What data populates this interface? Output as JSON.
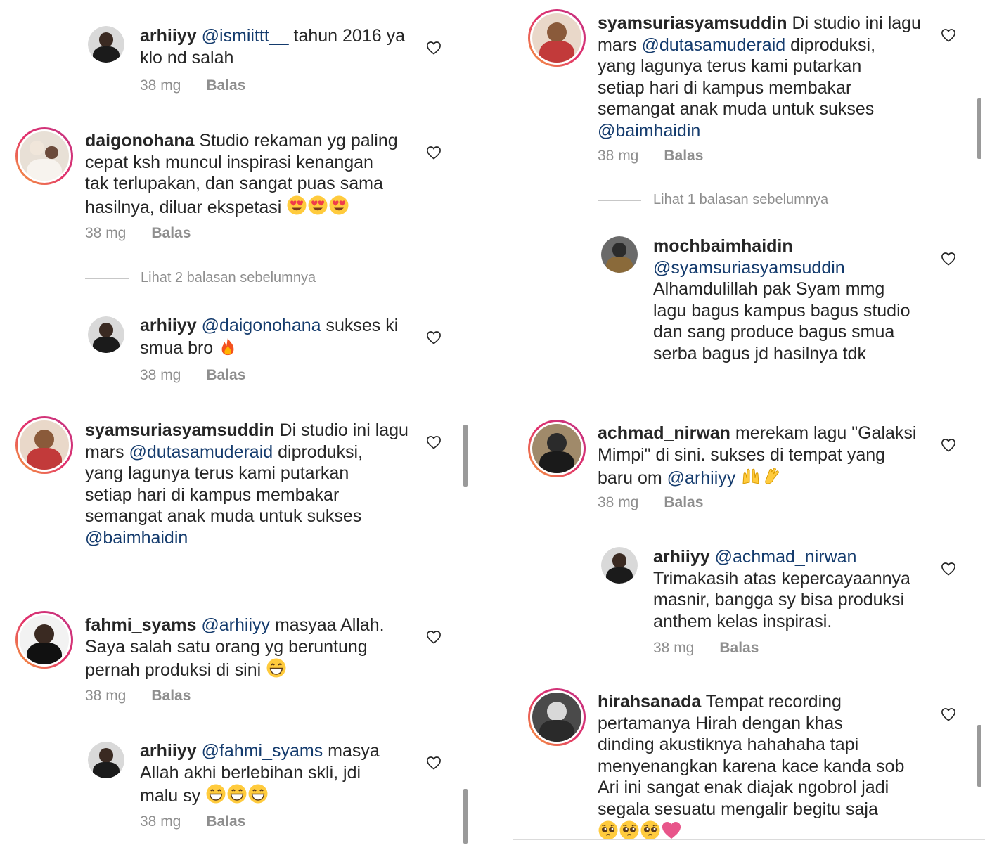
{
  "meta": {
    "time": "38 mg",
    "reply": "Balas"
  },
  "left": {
    "c1": {
      "user": "arhiiyy",
      "mention": "@ismiittt__",
      "text_a": " tahun 2016 ya",
      "text_b": "klo nd salah"
    },
    "c2": {
      "user": "daigonohana",
      "text_a": " Studio rekaman yg paling",
      "text_b": "cepat ksh muncul inspirasi kenangan",
      "text_c": "tak terlupakan, dan sangat puas sama",
      "text_d": "hasilnya, diluar ekspetasi "
    },
    "vr1": "Lihat 2 balasan sebelumnya",
    "c3": {
      "user": "arhiiyy",
      "mention": "@daigonohana",
      "text_a": " sukses ki",
      "text_b": "smua bro "
    },
    "c4": {
      "user": "syamsuriasyamsuddin",
      "text_a": " Di studio ini lagu",
      "text_b1": "mars ",
      "mention": "@dutasamuderaid",
      "text_b2": " diproduksi,",
      "text_c": "yang lagunya terus kami putarkan",
      "text_d": "setiap hari di kampus membakar",
      "text_e": "semangat anak muda untuk sukses",
      "mention2": "@baimhaidin"
    },
    "c5": {
      "user": "fahmi_syams",
      "mention": "@arhiiyy",
      "text_a": " masyaa Allah.",
      "text_b": "Saya salah satu orang yg beruntung",
      "text_c": "pernah produksi di sini "
    },
    "c6": {
      "user": "arhiiyy",
      "mention": "@fahmi_syams",
      "text_a": " masya",
      "text_b": "Allah akhi berlebihan skli,  jdi",
      "text_c": "malu sy "
    }
  },
  "right": {
    "c1": {
      "user": "syamsuriasyamsuddin",
      "text_a": " Di studio ini lagu",
      "text_b1": "mars ",
      "mention": "@dutasamuderaid",
      "text_b2": " diproduksi,",
      "text_c": "yang lagunya terus kami putarkan",
      "text_d": "setiap hari di kampus membakar",
      "text_e": "semangat anak muda untuk sukses",
      "mention2": "@baimhaidin"
    },
    "vr1": "Lihat 1 balasan sebelumnya",
    "c2": {
      "user": "mochbaimhaidin",
      "mention": "@syamsuriasyamsuddin",
      "text_a": "Alhamdulillah pak Syam mmg",
      "text_b": "lagu bagus kampus bagus studio",
      "text_c": "dan sang produce bagus smua",
      "text_d": "serba bagus jd hasilnya tdk"
    },
    "c3": {
      "user": "achmad_nirwan",
      "text_a": " merekam lagu \"Galaksi",
      "text_b": "Mimpi\" di sini. sukses di tempat yang",
      "text_c1": "baru om ",
      "mention": "@arhiiyy"
    },
    "c4": {
      "user": "arhiiyy",
      "mention": "@achmad_nirwan",
      "text_a": "Trimakasih atas kepercayaannya",
      "text_b": "masnir,  bangga sy bisa produksi",
      "text_c": "anthem kelas inspirasi."
    },
    "c5": {
      "user": "hirahsanada",
      "text_a": " Tempat recording",
      "text_b": "pertamanya Hirah dengan khas",
      "text_c": "dinding akustiknya hahahaha tapi",
      "text_d": "menyenangkan karena kace kanda sob",
      "text_e": "Ari ini sangat enak diajak ngobrol jadi",
      "text_f": "segala sesuatu mengalir begitu saja"
    }
  },
  "icons": {
    "like": "heart-outline-icon",
    "emoji_heart_eyes": "heart-eyes-emoji",
    "emoji_fire": "fire-emoji",
    "emoji_grin": "grinning-emoji",
    "emoji_raised_hands": "raised-hands-emoji",
    "emoji_clap": "clapping-hands-emoji",
    "emoji_pleading": "pleading-face-emoji",
    "emoji_pink_heart": "pink-heart-emoji"
  },
  "colors": {
    "text": "#262626",
    "mention": "#143b6d",
    "meta": "#8e8e8e",
    "ring_start": "#f7a23b",
    "ring_end": "#c13584"
  }
}
